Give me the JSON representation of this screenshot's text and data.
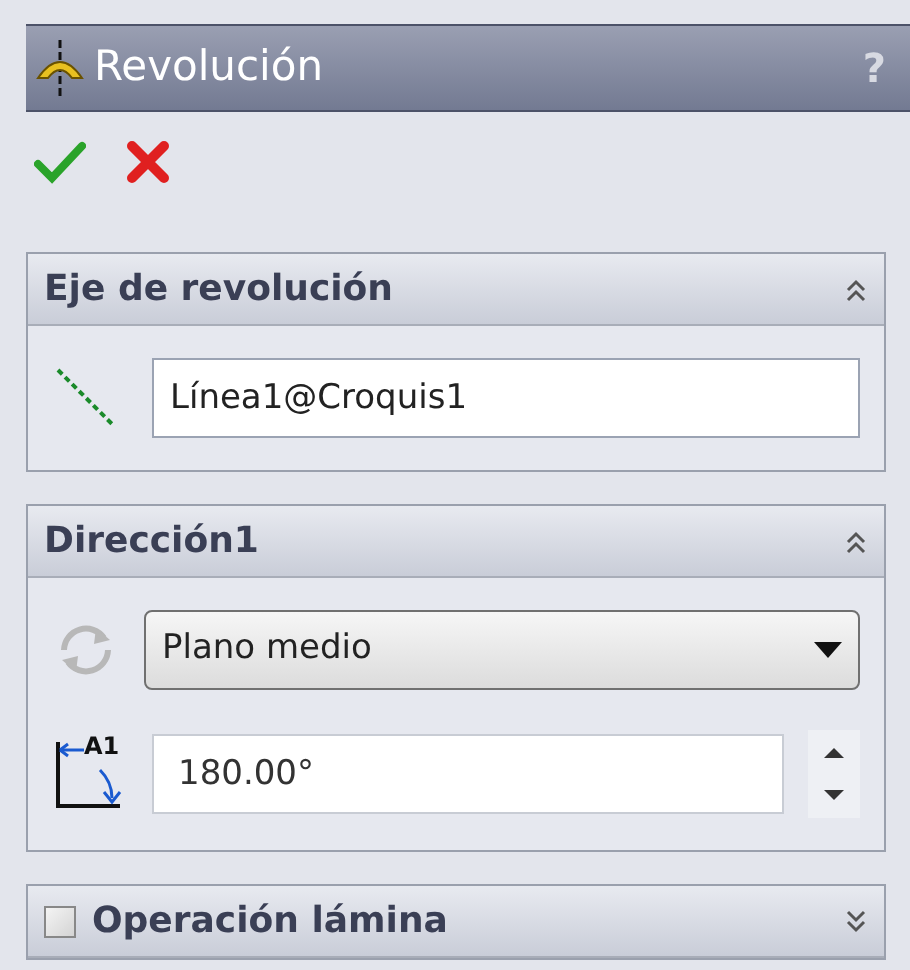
{
  "window": {
    "title": "Revolución",
    "help": "?"
  },
  "sections": [
    {
      "kind": "axis",
      "title": "Eje de revolución",
      "expanded": true,
      "value": "Línea1@Croquis1"
    },
    {
      "kind": "direction",
      "title": "Dirección1",
      "expanded": true,
      "dropdown": "Plano medio",
      "angle_label": "A1",
      "angle": "180.00°"
    },
    {
      "kind": "option",
      "title": "Operación lámina",
      "expanded": false,
      "checked": false
    }
  ]
}
